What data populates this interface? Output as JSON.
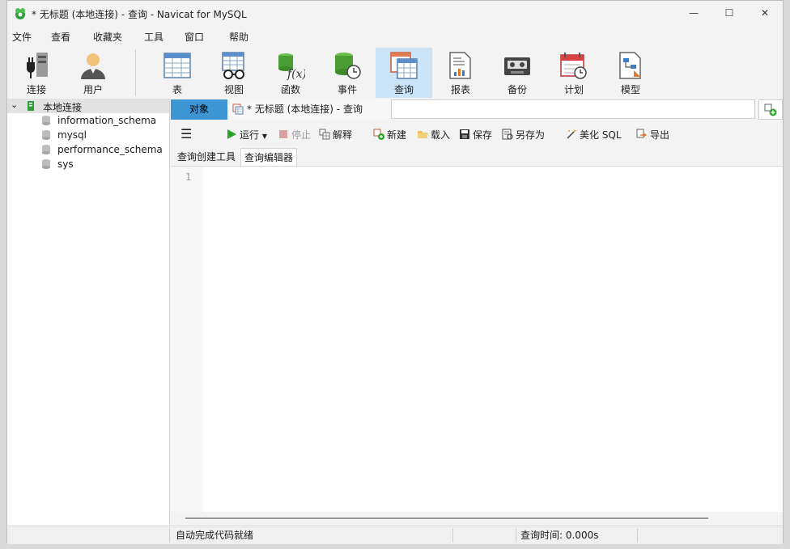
{
  "window": {
    "title": "* 无标题 (本地连接) - 查询 - Navicat for MySQL",
    "controls": {
      "minimize": "—",
      "maximize": "☐",
      "close": "✕"
    }
  },
  "menu": [
    "文件",
    "查看",
    "收藏夹",
    "工具",
    "窗口",
    "帮助"
  ],
  "toolbar": [
    {
      "label": "连接",
      "icon": "connection-plug-icon"
    },
    {
      "label": "用户",
      "icon": "user-icon"
    },
    {
      "label": "表",
      "icon": "table-icon"
    },
    {
      "label": "视图",
      "icon": "view-glasses-icon"
    },
    {
      "label": "函数",
      "icon": "function-icon"
    },
    {
      "label": "事件",
      "icon": "event-icon"
    },
    {
      "label": "查询",
      "icon": "query-icon",
      "active": true
    },
    {
      "label": "报表",
      "icon": "report-icon"
    },
    {
      "label": "备份",
      "icon": "backup-icon"
    },
    {
      "label": "计划",
      "icon": "schedule-calendar-icon"
    },
    {
      "label": "模型",
      "icon": "model-icon"
    }
  ],
  "navigator": {
    "connection": "本地连接",
    "databases": [
      "information_schema",
      "mysql",
      "performance_schema",
      "sys"
    ]
  },
  "tabs": {
    "objects": "对象",
    "query": "* 无标题 (本地连接) - 查询"
  },
  "query_toolbar": {
    "run": "运行",
    "stop": "停止",
    "explain": "解释",
    "new": "新建",
    "load": "载入",
    "save": "保存",
    "save_as": "另存为",
    "beautify": "美化 SQL",
    "export": "导出"
  },
  "subtabs": {
    "builder": "查询创建工具",
    "editor": "查询编辑器"
  },
  "editor": {
    "line_numbers": [
      "1"
    ]
  },
  "status": {
    "message": "自动完成代码就绪",
    "query_time": "查询时间: 0.000s"
  },
  "colors": {
    "accent": "#3d95d4",
    "active_toolbar": "#cce4f7",
    "run_green": "#2aa52a"
  }
}
